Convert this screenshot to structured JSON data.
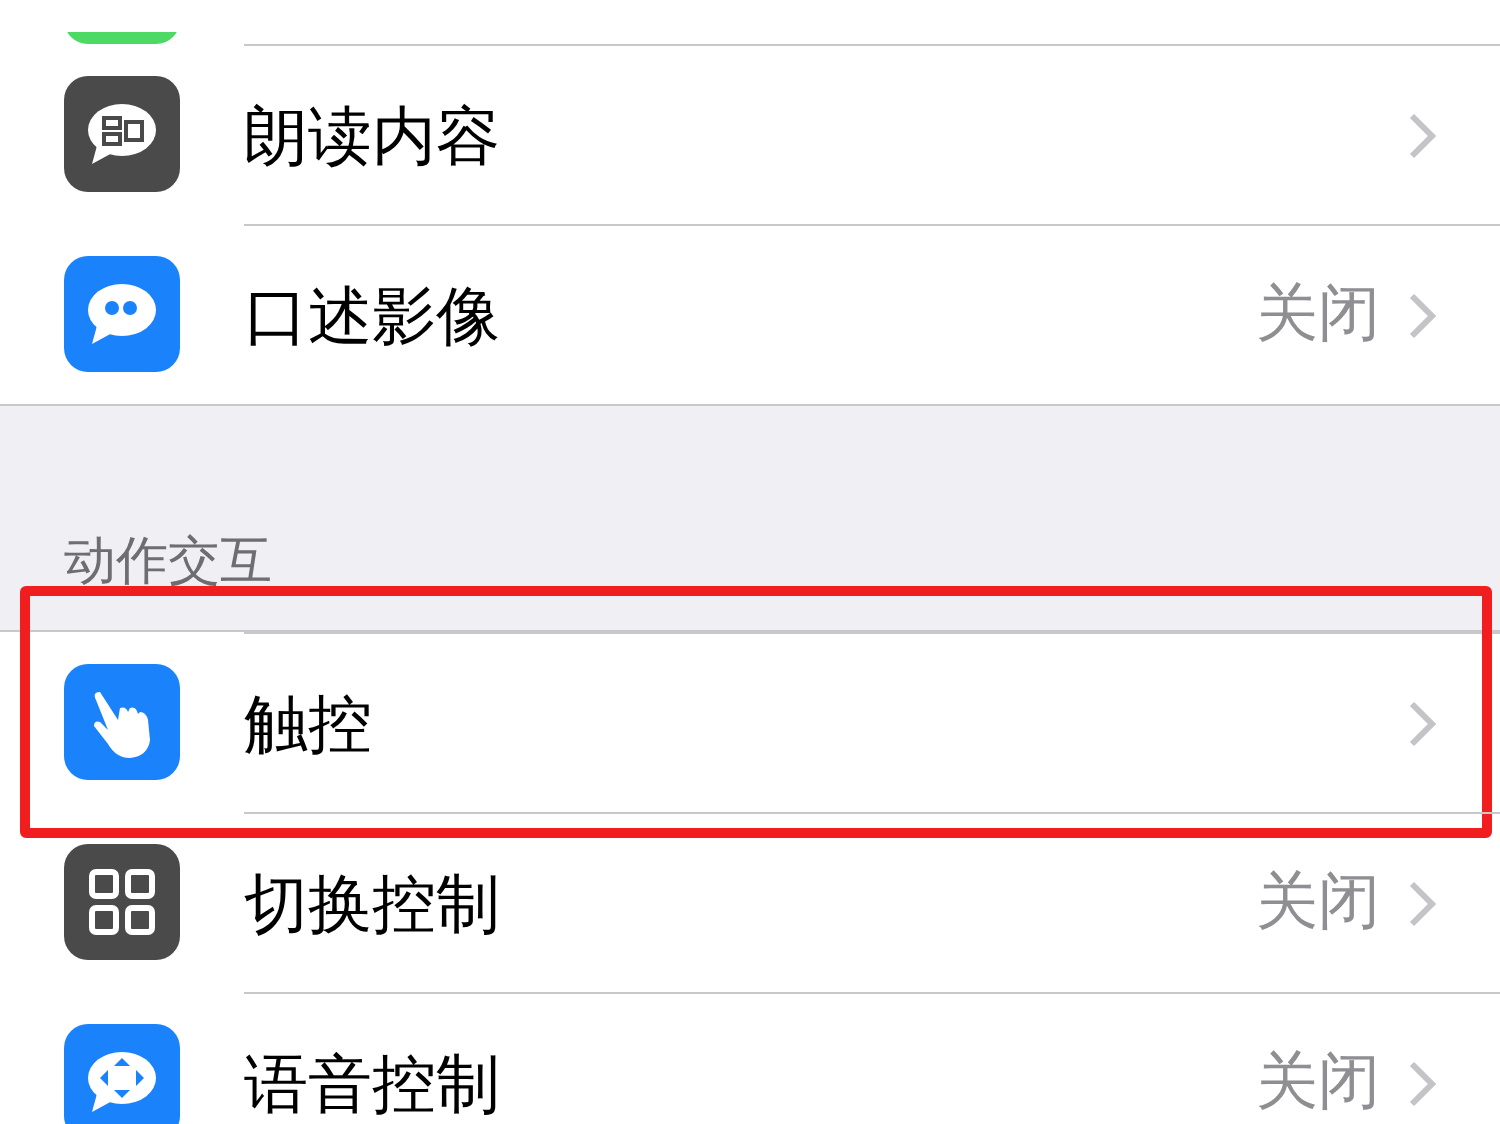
{
  "cut_row": {
    "color": "#4cd964"
  },
  "groups": [
    {
      "items": [
        {
          "label": "朗读内容",
          "color": "#4a4a4a",
          "highlighted": false
        },
        {
          "label": "口述影像",
          "value": "关闭",
          "color": "#1a82fb",
          "highlighted": false
        }
      ]
    },
    {
      "header": "动作交互",
      "items": [
        {
          "label": "触控",
          "color": "#1a82fb",
          "highlighted": true
        },
        {
          "label": "切换控制",
          "value": "关闭",
          "color": "#4a4a4a",
          "highlighted": false
        },
        {
          "label": "语音控制",
          "value": "关闭",
          "color": "#1a82fb",
          "highlighted": false
        }
      ]
    }
  ]
}
